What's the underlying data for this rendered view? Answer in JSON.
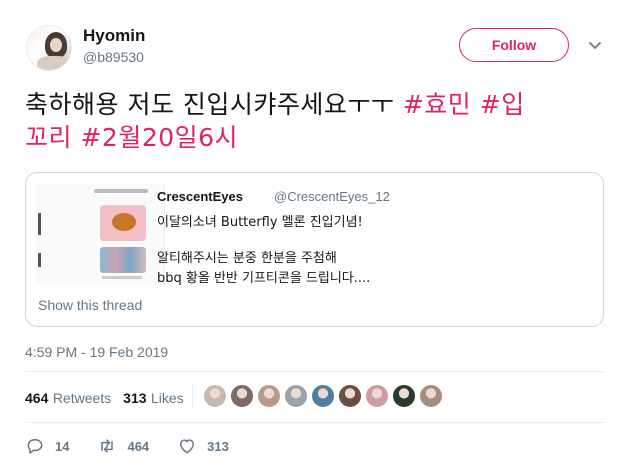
{
  "author": {
    "name": "Hyomin",
    "handle": "@b89530"
  },
  "follow_label": "Follow",
  "tweet": {
    "text_plain": "축하해용 저도 진입시캬주세요ㅜㅜ ",
    "hashtag1": "#효민",
    "hashtag2_line1": "#입",
    "hashtag2_line2": "꼬리",
    "hashtag3": "#2월20일6시"
  },
  "quote": {
    "name": "CrescentEyes",
    "handle": "@CrescentEyes_12",
    "lines": [
      "이달의소녀 Butterfly 멜론 진입기념!",
      "알티해주시는 분중 한분을 주첨해",
      "bbq 황올 반반 기프티콘을 드립니다...."
    ],
    "show_thread": "Show this thread"
  },
  "timestamp": "4:59 PM - 19 Feb 2019",
  "stats": {
    "retweets_count": "464",
    "retweets_label": "Retweets",
    "likes_count": "313",
    "likes_label": "Likes"
  },
  "liker_colors": [
    "#c9b8b0",
    "#7d6a62",
    "#b59b8a",
    "#9aa3ab",
    "#4d7fa3",
    "#6b4f3f",
    "#d29aa2",
    "#2f3a2f",
    "#a68d7c"
  ],
  "actions": {
    "reply_count": "14",
    "retweet_count": "464",
    "like_count": "313"
  },
  "icons": {
    "reply": "reply-icon",
    "retweet": "retweet-icon",
    "like": "heart-icon",
    "menu": "chevron-down-icon"
  }
}
